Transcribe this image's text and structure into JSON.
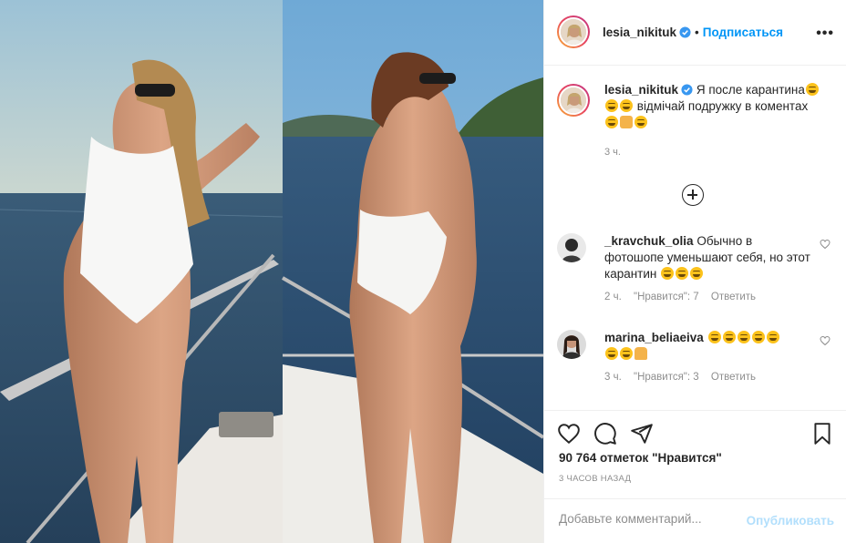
{
  "post": {
    "author": "lesia_nikituk",
    "follow_label": "Подписаться",
    "separator": "•",
    "more_label": "•••"
  },
  "caption": {
    "author": "lesia_nikituk",
    "line1": "Я после карантина",
    "line2": "відмічай подружку в коментах",
    "time": "3 ч."
  },
  "comments": [
    {
      "user": "_kravchuk_olia",
      "text": "Обычно в фотошопе уменьшают себя, но этот карантин",
      "time": "2 ч.",
      "likes": "\"Нравится\": 7",
      "reply": "Ответить"
    },
    {
      "user": "marina_beliaeiva",
      "text": "",
      "time": "3 ч.",
      "likes": "\"Нравится\": 3",
      "reply": "Ответить"
    }
  ],
  "footer": {
    "likes": "90 764 отметок \"Нравится\"",
    "posted": "3 ЧАСОВ НАЗАД",
    "comment_placeholder": "Добавьте комментарий...",
    "publish_label": "Опубликовать"
  },
  "icons": {
    "like": "heart-icon",
    "comment": "comment-icon",
    "share": "share-icon",
    "save": "bookmark-icon",
    "verified": "verified-badge-icon",
    "load_more": "plus-circle-icon"
  },
  "colors": {
    "link": "#0095f6",
    "verified": "#3897f0",
    "muted": "#8e8e8e",
    "publish_disabled": "#b2dffc"
  }
}
